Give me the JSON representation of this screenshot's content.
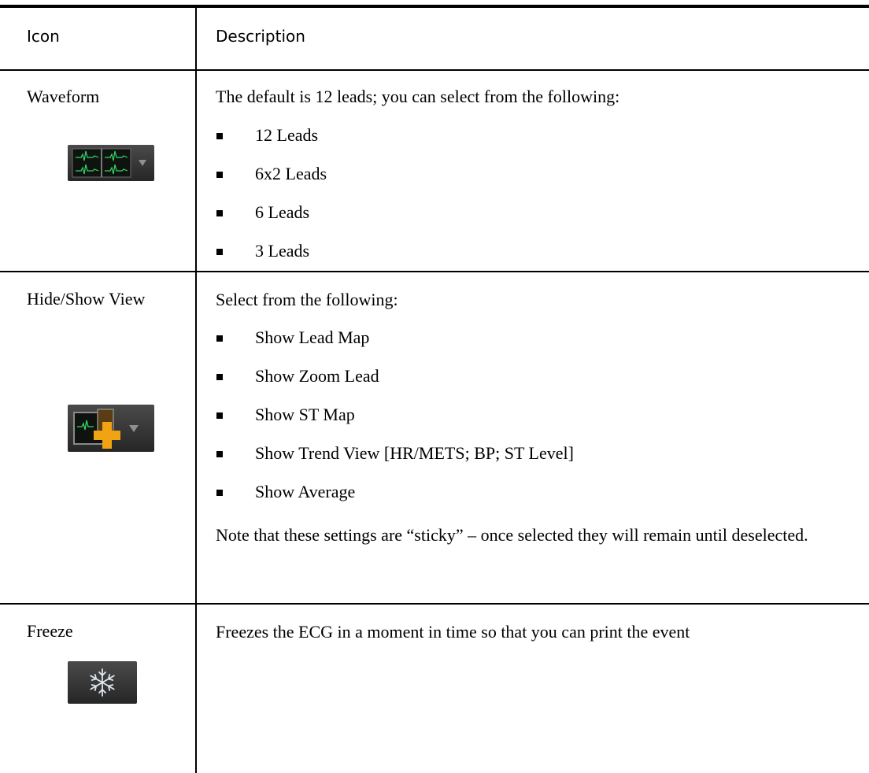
{
  "table": {
    "headers": {
      "icon": "Icon",
      "description": "Description"
    },
    "rows": [
      {
        "icon_label": "Waveform",
        "icon": "waveform-icon",
        "intro": "The default is 12 leads; you can select from the following:",
        "options": [
          "12 Leads",
          "6x2 Leads",
          "6 Leads",
          "3 Leads"
        ]
      },
      {
        "icon_label": "Hide/Show View",
        "icon": "hide-show-view-icon",
        "intro": "Select from the following:",
        "options": [
          "Show Lead Map",
          "Show Zoom Lead",
          "Show ST Map",
          "Show Trend View [HR/METS; BP; ST Level]",
          "Show Average"
        ],
        "note": "Note that these settings are “sticky” – once selected they will remain until deselected."
      },
      {
        "icon_label": "Freeze",
        "icon": "snowflake-icon",
        "intro": "Freezes the ECG in a moment in time so that you can print the event"
      }
    ]
  },
  "colors": {
    "icon_background": "#303030",
    "ecg_trace": "#36d46a",
    "accent_orange": "#f2a313",
    "snowflake": "#dfe6ee"
  }
}
